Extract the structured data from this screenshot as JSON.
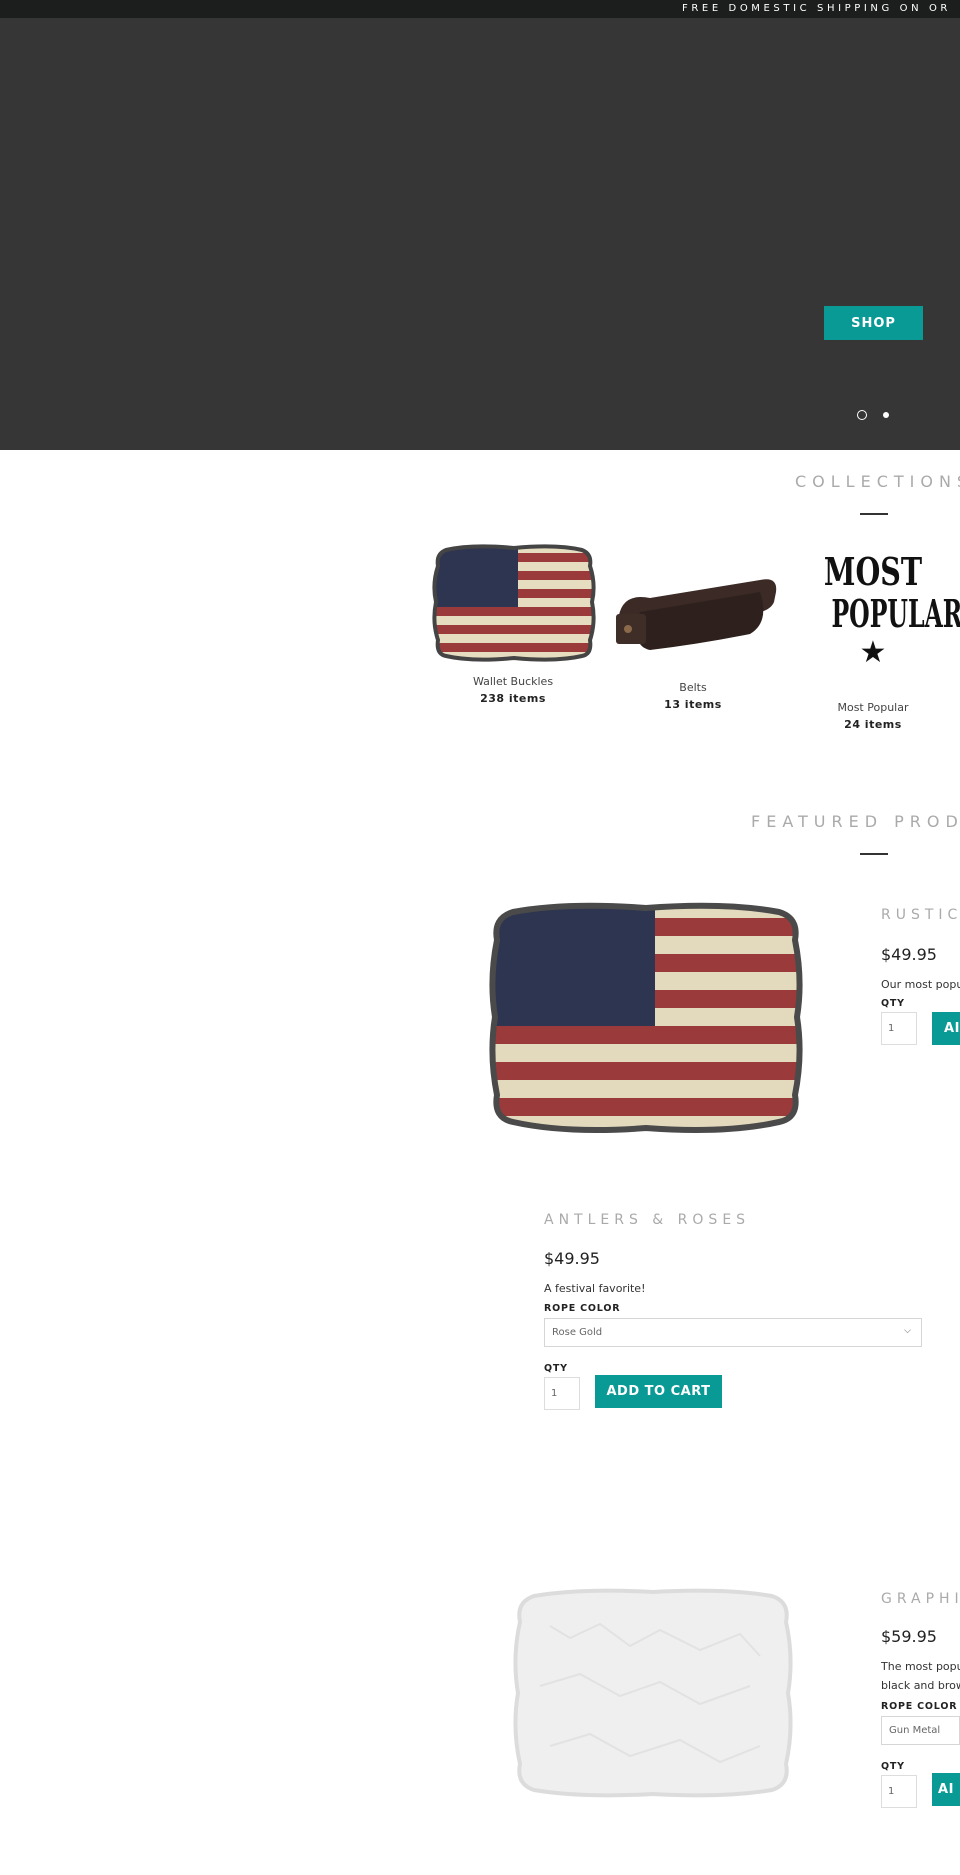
{
  "announcement": "FREE DOMESTIC SHIPPING ON OR",
  "hero": {
    "button_label": "SHOP",
    "slide_count": 2,
    "active_slide": 2
  },
  "collections": {
    "title": "COLLECTIONS",
    "items": [
      {
        "name": "Wallet Buckles",
        "count": "238 items"
      },
      {
        "name": "Belts",
        "count": "13 items"
      },
      {
        "name": "Most Popular",
        "count": "24 items",
        "image_text": [
          "MOST",
          "POPULAR"
        ]
      }
    ]
  },
  "featured": {
    "title": "FEATURED PRODUC",
    "products": [
      {
        "title": "RUSTIC",
        "price": "$49.95",
        "description": "Our most popu",
        "qty_label": "QTY",
        "qty": "1",
        "button_label": "AI"
      },
      {
        "title": "ANTLERS & ROSES",
        "price": "$49.95",
        "description": "A festival favorite!",
        "option_label": "ROPE COLOR",
        "option_value": "Rose Gold",
        "qty_label": "QTY",
        "qty": "1",
        "button_label": "ADD TO CART"
      },
      {
        "title": "GRAPHI",
        "price": "$59.95",
        "description_lines": [
          "The most popu",
          "black and brow"
        ],
        "option_label": "ROPE COLOR",
        "option_value": "Gun Metal",
        "qty_label": "QTY",
        "qty": "1",
        "button_label": "AI"
      }
    ]
  },
  "colors": {
    "accent": "#0a9a96",
    "hero_bg": "#363636",
    "announce_bg": "#1c1d1d"
  }
}
